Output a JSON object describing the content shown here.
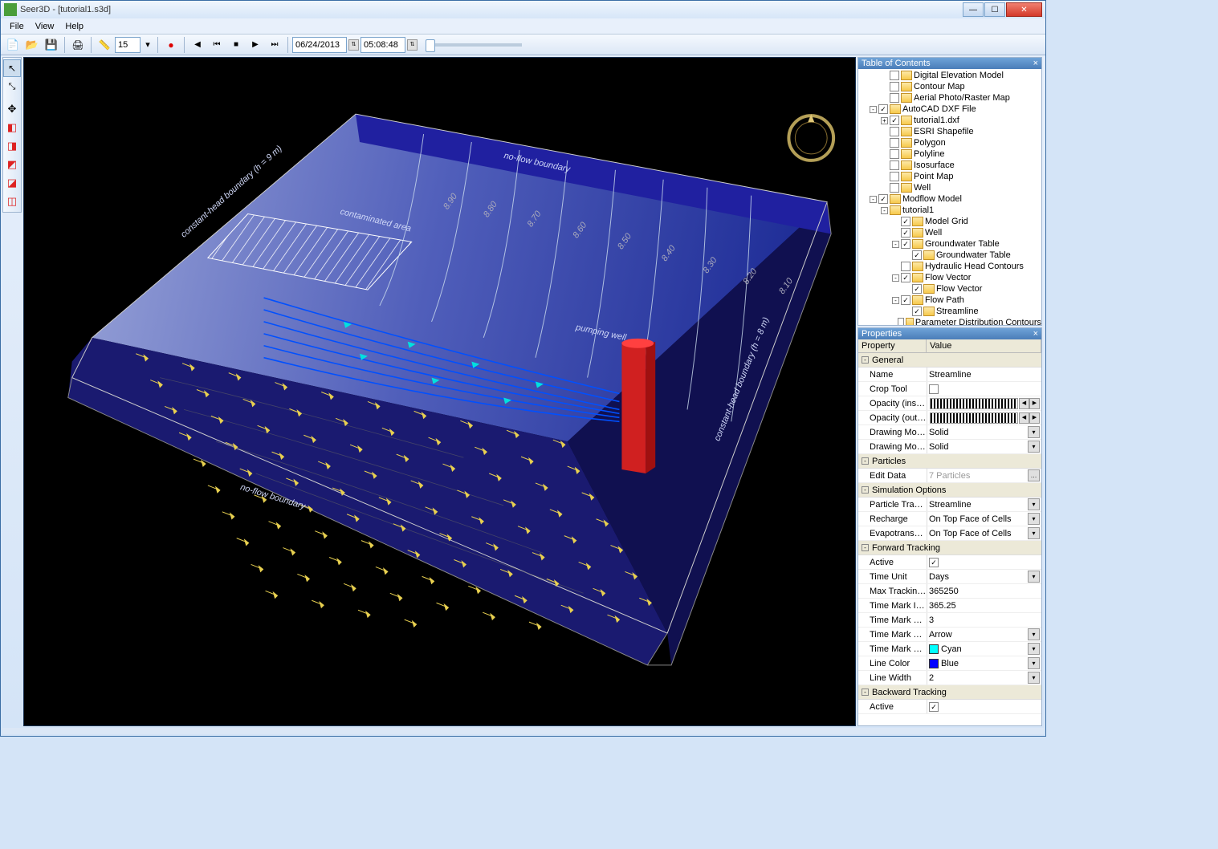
{
  "app": {
    "title": "Seer3D - [tutorial1.s3d]"
  },
  "menu": {
    "file": "File",
    "view": "View",
    "help": "Help"
  },
  "toolbar": {
    "frame_value": "15",
    "date_value": "06/24/2013",
    "time_value": "05:08:48"
  },
  "view": {
    "labels": {
      "noflow_top": "no-flow boundary",
      "noflow_bottom": "no-flow boundary",
      "ch_left": "constant-head boundary (h = 9 m)",
      "ch_right": "constant-head boundary (h = 8 m)",
      "contaminated": "contaminated area",
      "well": "pumping well"
    },
    "contours": [
      "8.90",
      "8.80",
      "8.70",
      "8.60",
      "8.50",
      "8.40",
      "8.30",
      "8.20",
      "8.10"
    ]
  },
  "toc": {
    "title": "Table of Contents",
    "items": [
      {
        "indent": 2,
        "exp": "",
        "cb": false,
        "label": "Digital Elevation Model"
      },
      {
        "indent": 2,
        "exp": "",
        "cb": false,
        "label": "Contour Map"
      },
      {
        "indent": 2,
        "exp": "",
        "cb": false,
        "label": "Aerial Photo/Raster Map"
      },
      {
        "indent": 1,
        "exp": "-",
        "cb": true,
        "label": "AutoCAD DXF File"
      },
      {
        "indent": 2,
        "exp": "+",
        "cb": true,
        "label": "tutorial1.dxf"
      },
      {
        "indent": 2,
        "exp": "",
        "cb": false,
        "label": "ESRI Shapefile"
      },
      {
        "indent": 2,
        "exp": "",
        "cb": false,
        "label": "Polygon"
      },
      {
        "indent": 2,
        "exp": "",
        "cb": false,
        "label": "Polyline"
      },
      {
        "indent": 2,
        "exp": "",
        "cb": false,
        "label": "Isosurface"
      },
      {
        "indent": 2,
        "exp": "",
        "cb": false,
        "label": "Point Map"
      },
      {
        "indent": 2,
        "exp": "",
        "cb": false,
        "label": "Well"
      },
      {
        "indent": 1,
        "exp": "-",
        "cb": true,
        "label": "Modflow Model"
      },
      {
        "indent": 2,
        "exp": "-",
        "cb": "none",
        "label": "tutorial1"
      },
      {
        "indent": 3,
        "exp": "",
        "cb": true,
        "label": "Model Grid"
      },
      {
        "indent": 3,
        "exp": "",
        "cb": true,
        "label": "Well"
      },
      {
        "indent": 3,
        "exp": "-",
        "cb": true,
        "label": "Groundwater Table"
      },
      {
        "indent": 4,
        "exp": "",
        "cb": true,
        "label": "Groundwater Table"
      },
      {
        "indent": 3,
        "exp": "",
        "cb": false,
        "label": "Hydraulic Head Contours"
      },
      {
        "indent": 3,
        "exp": "-",
        "cb": true,
        "label": "Flow Vector"
      },
      {
        "indent": 4,
        "exp": "",
        "cb": true,
        "label": "Flow Vector"
      },
      {
        "indent": 3,
        "exp": "-",
        "cb": true,
        "label": "Flow Path"
      },
      {
        "indent": 4,
        "exp": "",
        "cb": true,
        "label": "Streamline"
      },
      {
        "indent": 3,
        "exp": "",
        "cb": false,
        "label": "Parameter Distribution Contours"
      }
    ]
  },
  "props": {
    "title": "Properties",
    "hdr_prop": "Property",
    "hdr_val": "Value",
    "cats": [
      {
        "cat": "General",
        "rows": [
          {
            "k": "Name",
            "v": "Streamline",
            "t": "text"
          },
          {
            "k": "Crop Tool",
            "v": false,
            "t": "check"
          },
          {
            "k": "Opacity (inside crop)",
            "v": "",
            "t": "opacity"
          },
          {
            "k": "Opacity (outside crop)",
            "v": "",
            "t": "opacity"
          },
          {
            "k": "Drawing Mode (inside)",
            "v": "Solid",
            "t": "select"
          },
          {
            "k": "Drawing Mode (outside)",
            "v": "Solid",
            "t": "select"
          }
        ]
      },
      {
        "cat": "Particles",
        "rows": [
          {
            "k": "Edit Data",
            "v": "7 Particles",
            "t": "editbtn"
          }
        ]
      },
      {
        "cat": "Simulation Options",
        "rows": [
          {
            "k": "Particle Tracking",
            "v": "Streamline",
            "t": "select"
          },
          {
            "k": "Recharge",
            "v": "On Top Face of Cells",
            "t": "select"
          },
          {
            "k": "Evapotranspiration",
            "v": "On Top Face of Cells",
            "t": "select"
          }
        ]
      },
      {
        "cat": "Forward Tracking",
        "rows": [
          {
            "k": "Active",
            "v": true,
            "t": "check"
          },
          {
            "k": "Time Unit",
            "v": "Days",
            "t": "select"
          },
          {
            "k": "Max Tracking Time",
            "v": "365250",
            "t": "text"
          },
          {
            "k": "Time Mark Interval",
            "v": "365.25",
            "t": "text"
          },
          {
            "k": "Time Mark Size",
            "v": "3",
            "t": "text"
          },
          {
            "k": "Time Mark Type",
            "v": "Arrow",
            "t": "select"
          },
          {
            "k": "Time Mark Color",
            "v": "Cyan",
            "t": "color",
            "sw": "#00ffff"
          },
          {
            "k": "Line Color",
            "v": "Blue",
            "t": "color",
            "sw": "#0000ff"
          },
          {
            "k": "Line Width",
            "v": "2",
            "t": "select"
          }
        ]
      },
      {
        "cat": "Backward Tracking",
        "rows": [
          {
            "k": "Active",
            "v": true,
            "t": "check"
          }
        ]
      }
    ]
  }
}
